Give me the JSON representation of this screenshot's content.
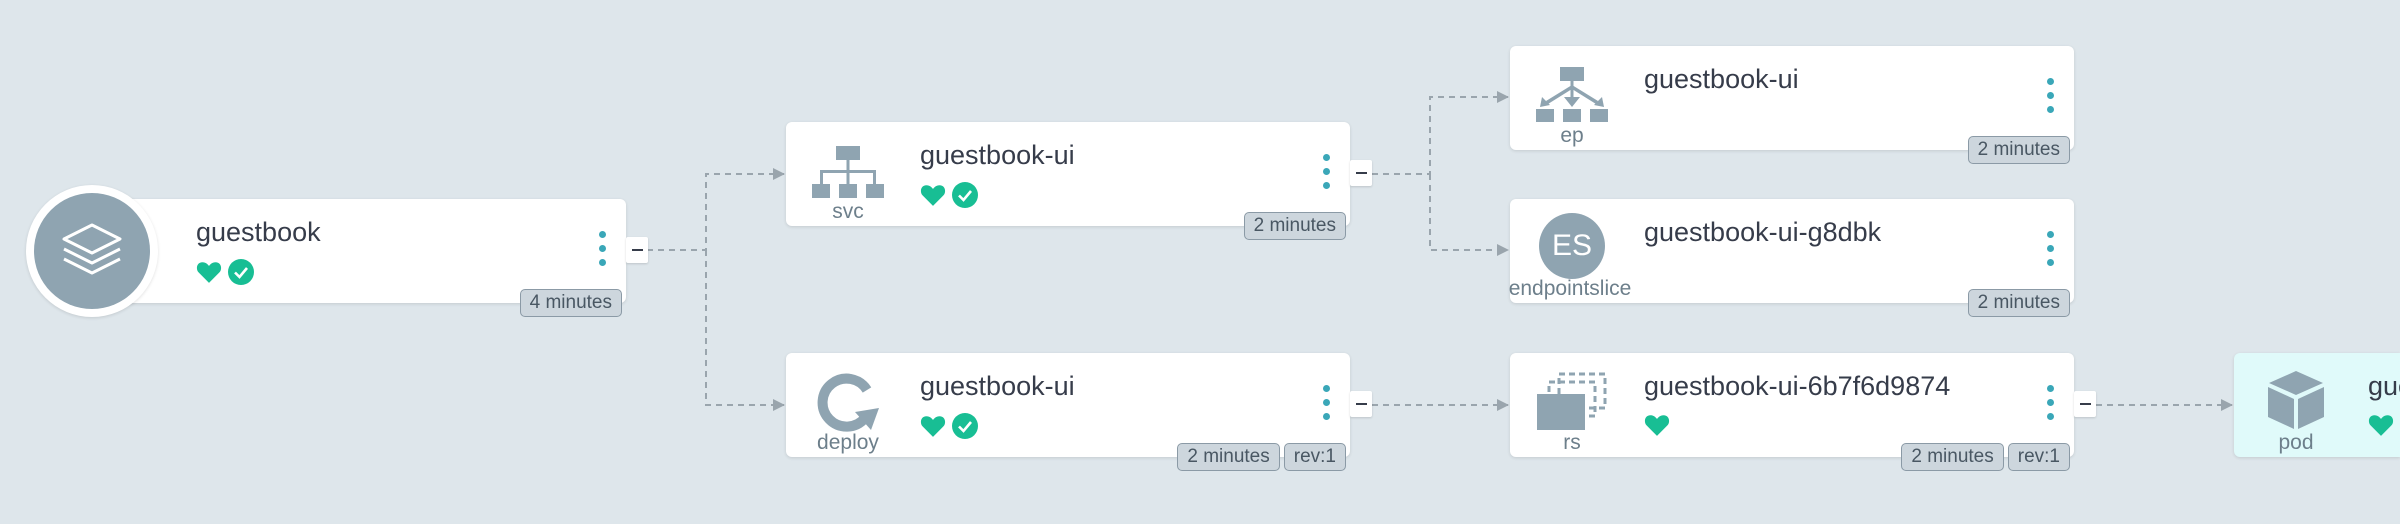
{
  "colors": {
    "background": "#dee6eb",
    "healthy": "#18be94",
    "kebab": "#3aa7b8",
    "icon": "#8fa4b1",
    "pod_background": "#e0fafa"
  },
  "nodes": {
    "app": {
      "name": "guestbook",
      "icon": "layers-icon",
      "health": "healthy-heart-icon",
      "sync": "synced-check-icon",
      "tags": [
        "4 minutes"
      ]
    },
    "svc": {
      "kind": "svc",
      "name": "guestbook-ui",
      "icon": "service-icon",
      "tags": [
        "2 minutes"
      ]
    },
    "ep": {
      "kind": "ep",
      "name": "guestbook-ui",
      "icon": "endpoints-icon",
      "tags": [
        "2 minutes"
      ]
    },
    "endpointslice": {
      "kind": "endpointslice",
      "initials": "ES",
      "name": "guestbook-ui-g8dbk",
      "tags": [
        "2 minutes"
      ]
    },
    "deploy": {
      "kind": "deploy",
      "name": "guestbook-ui",
      "icon": "deployment-icon",
      "tags": [
        "2 minutes",
        "rev:1"
      ]
    },
    "rs": {
      "kind": "rs",
      "name": "guestbook-ui-6b7f6d9874",
      "icon": "replicaset-icon",
      "tags": [
        "2 minutes",
        "rev:1"
      ]
    },
    "pod": {
      "kind": "pod",
      "name": "gue",
      "icon": "pod-icon"
    }
  }
}
